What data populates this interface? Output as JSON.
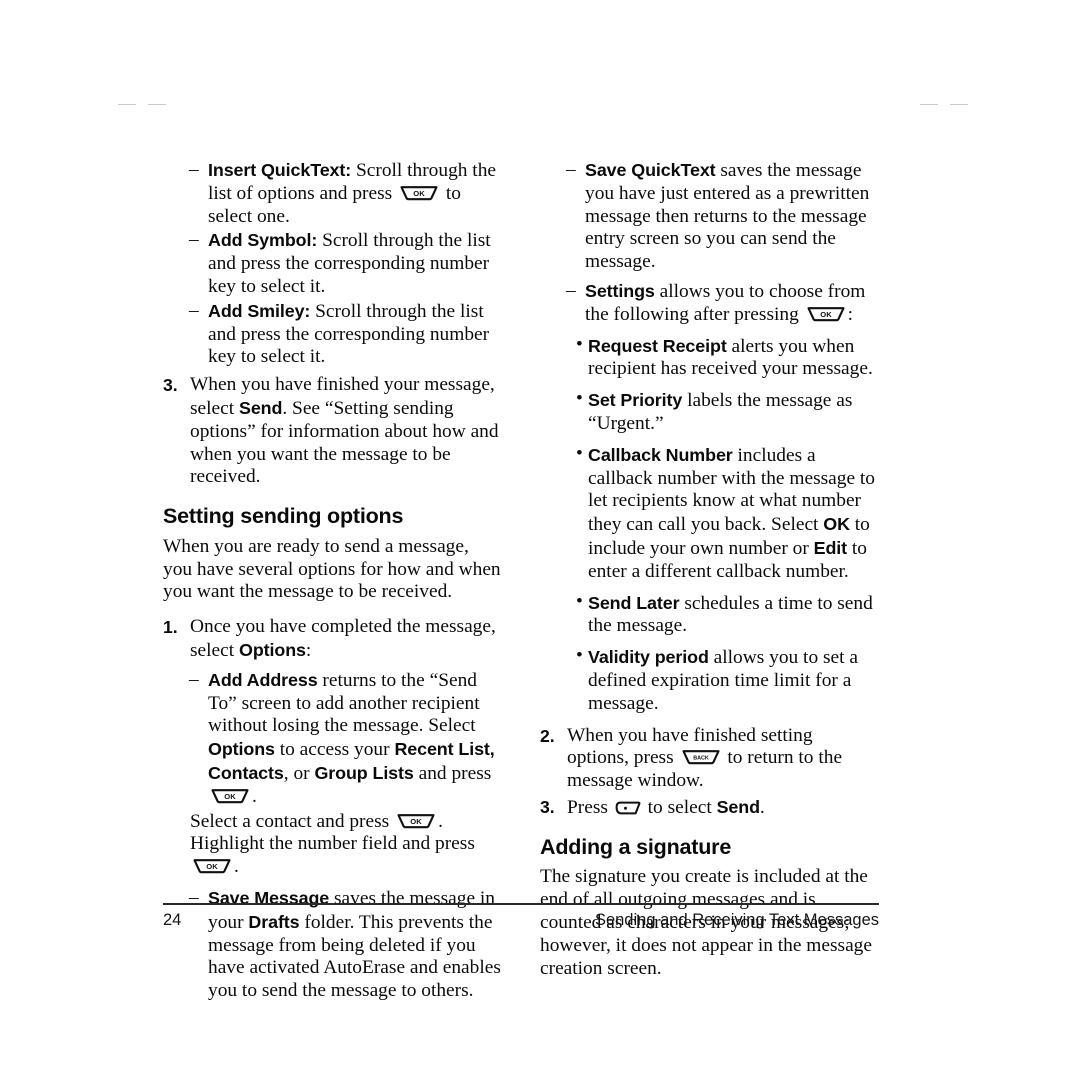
{
  "page": {
    "number": "24",
    "chapter": "Sending and Receiving Text Messages"
  },
  "icons": {
    "ok_key": "ok-key-icon",
    "back_key": "back-key-icon",
    "send_key": "send-key-icon",
    "ok_label": "OK",
    "back_label": "BACK"
  },
  "left_column": {
    "dash_items": [
      {
        "term": "Insert QuickText:",
        "text_before_key": " Scroll through the list of options and press ",
        "text_after_key": " to select one."
      },
      {
        "term": "Add Symbol:",
        "text": " Scroll through the list and press the corresponding number key to select it."
      },
      {
        "term": "Add Smiley:",
        "text": " Scroll through the list and press the corresponding number key to select it."
      }
    ],
    "step3": {
      "num": "3.",
      "part1": "When you have finished your message, select ",
      "bold1": "Send",
      "part2": ". See “Setting sending options” for information about how and when you want the message to be received."
    },
    "heading": "Setting sending options",
    "intro": "When you are ready to send a message, you have several options for how and when you want the message to be received.",
    "step1": {
      "num": "1.",
      "part1": "Once you have completed the message, select ",
      "bold1": "Options",
      "part2": ":"
    },
    "add_address": {
      "term": "Add Address",
      "part1": " returns to the “Send To” screen to add another recipient without losing the message. Select ",
      "bold1": "Options",
      "part2": " to access your ",
      "bold2": "Recent List, Contacts",
      "part3": ", or ",
      "bold3": "Group Lists",
      "part4": " and press ",
      "part5": "."
    },
    "contact_line": {
      "part1": "Select a contact and press ",
      "part2": "."
    },
    "number_field_line": {
      "part1": "Highlight the number field and press ",
      "part2": "."
    },
    "save_message": {
      "term": "Save Message",
      "part1": " saves the message in your ",
      "bold1": "Drafts",
      "part2": " folder. This prevents the message from being deleted if you have activated AutoErase and enables you to send the message to others."
    }
  },
  "right_column": {
    "save_quicktext": {
      "term": "Save QuickText",
      "text": " saves the message you have just entered as a prewritten message then returns to the message entry screen so you can send the message."
    },
    "settings": {
      "term": "Settings",
      "part1": " allows you to choose from the following after pressing ",
      "part2": ":"
    },
    "bullets": [
      {
        "term": "Request Receipt",
        "text": " alerts you when recipient has received your message."
      },
      {
        "term": "Set Priority",
        "text": " labels the message as “Urgent.”"
      },
      {
        "term": "Callback Number",
        "part1": " includes a callback number with the message to let recipients know at what number they can call you back. Select ",
        "bold1": "OK",
        "part2": " to include your own number or ",
        "bold2": "Edit",
        "part3": " to enter a different callback number."
      },
      {
        "term": "Send Later",
        "text": " schedules a time to send the message."
      },
      {
        "term": "Validity period",
        "text": " allows you to set a defined expiration time limit for a message."
      }
    ],
    "step2": {
      "num": "2.",
      "part1": "When you have finished setting options, press ",
      "part2": " to return to the message window."
    },
    "step3": {
      "num": "3.",
      "part1": "Press ",
      "part2": " to select ",
      "bold1": "Send",
      "part3": "."
    },
    "heading": "Adding a signature",
    "signature_text": "The signature you create is included at the end of all outgoing messages and is counted as characters in your messages; however, it does not appear in the message creation screen."
  }
}
